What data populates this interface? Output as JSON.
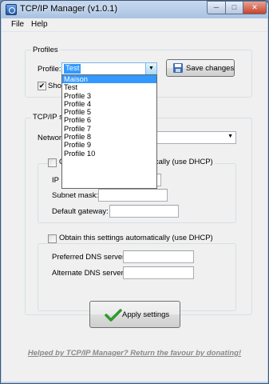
{
  "window": {
    "title": "TCP/IP Manager (v1.0.1)",
    "minimize_symbol": "─",
    "maximize_symbol": "□",
    "close_symbol": "✕"
  },
  "menu": {
    "file": "File",
    "help": "Help"
  },
  "profiles": {
    "legend": "Profiles",
    "profile_label": "Profile:",
    "selected_profile": "Test",
    "save_button": "Save changes",
    "show_checkbox_label": "Show",
    "show_checked": true,
    "dropdown_options": [
      "Maison",
      "Test",
      "Profile 3",
      "Profile 4",
      "Profile 5",
      "Profile 6",
      "Profile 7",
      "Profile 8",
      "Profile 9",
      "Profile 10"
    ],
    "highlighted_option": "Maison"
  },
  "tcpip": {
    "legend": "TCP/IP se",
    "network_label": "Network",
    "ip_group": {
      "dhcp_label": "Obtain this settings automatically (use DHCP)",
      "ip_label": "IP address:",
      "subnet_label": "Subnet mask:",
      "gateway_label": "Default gateway:"
    },
    "dns_group": {
      "dhcp_label": "Obtain this settings automatically (use DHCP)",
      "preferred_label": "Preferred DNS server:",
      "alternate_label": "Alternate DNS server:"
    }
  },
  "apply_button": "Apply settings",
  "footer_link": "Helped by TCP/IP Manager? Return the favour by donating!",
  "colors": {
    "highlight": "#3399ff",
    "titlebar": "#aac3e2",
    "link_grey": "#8a8a8a",
    "check_green": "#2e9a2e"
  },
  "icons": {
    "save": "floppy-disk-icon",
    "apply": "green-checkmark-icon",
    "app": "network-app-icon",
    "dropdown": "chevron-down-icon"
  }
}
